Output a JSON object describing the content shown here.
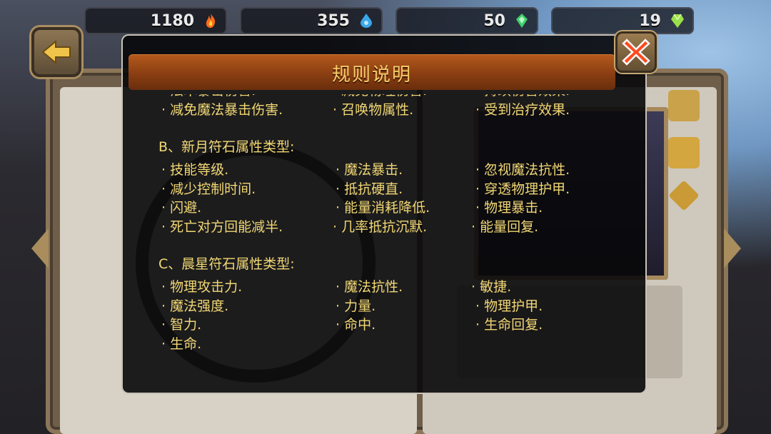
{
  "resources": [
    {
      "value": "1180",
      "icon": "flame-icon",
      "color": "#ff6a1a"
    },
    {
      "value": "355",
      "icon": "blue-drop-icon",
      "color": "#3aa7e8"
    },
    {
      "value": "50",
      "icon": "green-crystal-icon",
      "color": "#3fd16b"
    },
    {
      "value": "19",
      "icon": "green-gem-icon",
      "color": "#9be04a"
    }
  ],
  "modal": {
    "title": "规则说明",
    "rows_top_partial": [
      "· 法术暴击伤害.",
      "· 减免物理伤害.",
      "· 持续伤害效果."
    ],
    "rows_top": [
      "· 减免魔法暴击伤害.",
      "· 召唤物属性.",
      "· 受到治疗效果."
    ],
    "section_b": {
      "heading": "B、新月符石属性类型:",
      "rows": [
        [
          "· 技能等级.",
          "· 魔法暴击.",
          "· 忽视魔法抗性."
        ],
        [
          "· 减少控制时间.",
          "· 抵抗硬直.",
          "· 穿透物理护甲."
        ],
        [
          "· 闪避.",
          "· 能量消耗降低.",
          "· 物理暴击."
        ],
        [
          "· 死亡对方回能减半.",
          "· 几率抵抗沉默.",
          "· 能量回复."
        ]
      ]
    },
    "section_c": {
      "heading": "C、晨星符石属性类型:",
      "rows": [
        [
          "· 物理攻击力.",
          "· 魔法抗性.",
          "· 敏捷."
        ],
        [
          "· 魔法强度.",
          "· 力量.",
          "· 物理护甲."
        ],
        [
          "· 智力.",
          "· 命中.",
          "· 生命回复."
        ],
        [
          "· 生命.",
          "",
          ""
        ]
      ]
    }
  },
  "colors": {
    "title_text": "#f4cc6a",
    "body_text": "#f1d774",
    "title_bar": "#8a3e12"
  }
}
